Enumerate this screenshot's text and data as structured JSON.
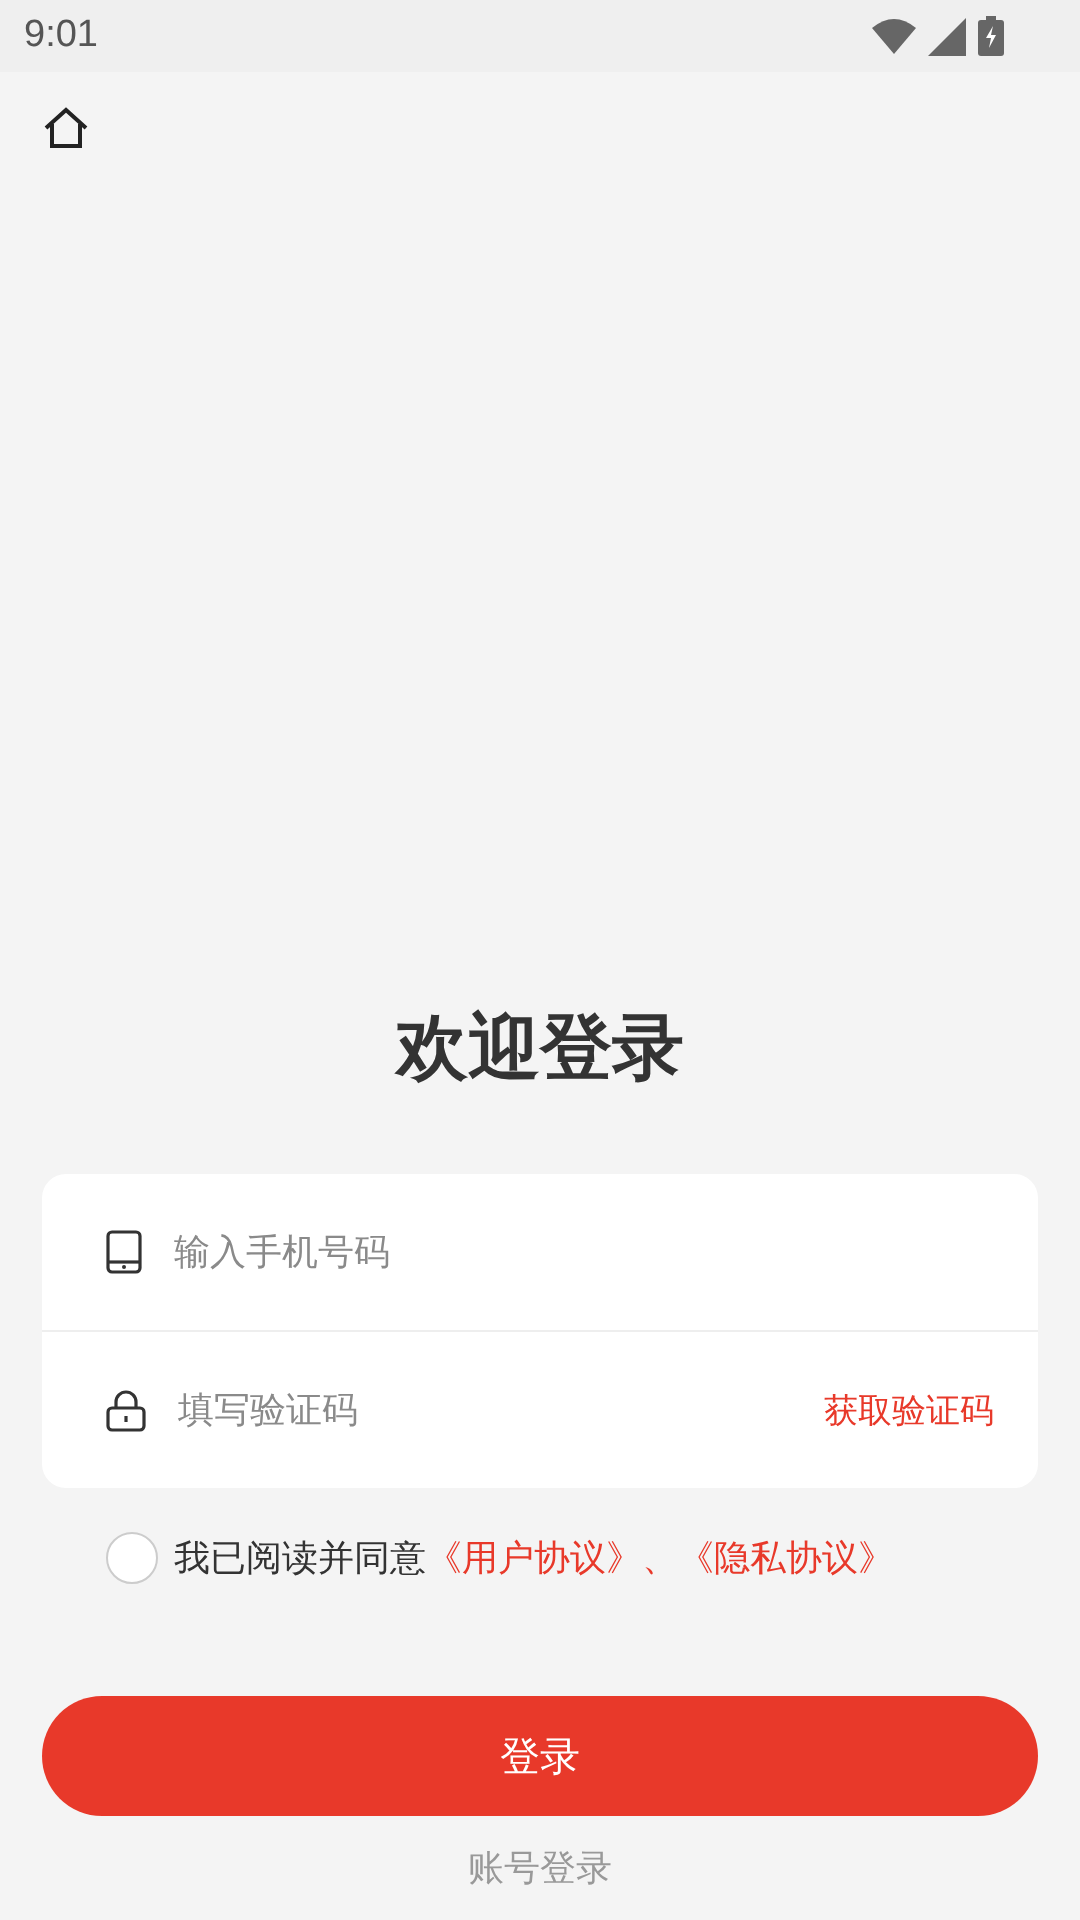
{
  "status_bar": {
    "time": "9:01"
  },
  "title": "欢迎登录",
  "form": {
    "phone": {
      "placeholder": "输入手机号码"
    },
    "code": {
      "placeholder": "填写验证码",
      "action": "获取验证码"
    }
  },
  "agreement": {
    "checked": false,
    "text": "我已阅读并同意",
    "links": [
      "《用户协议》",
      "《隐私协议》"
    ],
    "separator": "、"
  },
  "login_button": "登录",
  "alt_login": "账号登录"
}
